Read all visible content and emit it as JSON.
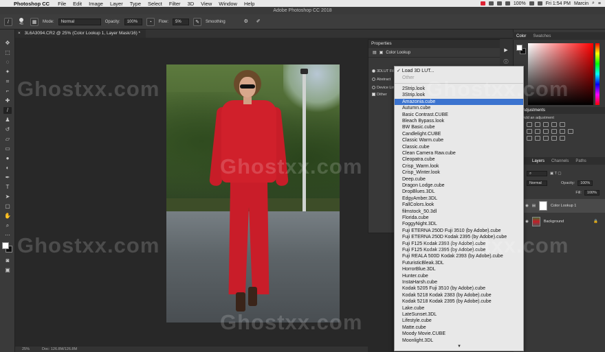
{
  "menubar": {
    "app": "Photoshop CC",
    "items": [
      "File",
      "Edit",
      "Image",
      "Layer",
      "Type",
      "Select",
      "Filter",
      "3D",
      "View",
      "Window",
      "Help"
    ],
    "battery": "100%",
    "datetime": "Fri 1:54 PM",
    "user": "Marcin"
  },
  "window_title": "Adobe Photoshop CC 2018",
  "options": {
    "brush_size": "45",
    "mode_label": "Mode:",
    "mode_value": "Normal",
    "opacity_label": "Opacity:",
    "opacity_value": "100%",
    "flow_label": "Flow:",
    "flow_value": "5%",
    "smoothing_label": "Smoothing"
  },
  "document_tab": "3L6A3094.CR2 @ 25% (Color Lookup 1, Layer Mask/16) *",
  "properties": {
    "title": "Properties",
    "subtitle": "Color Lookup",
    "opt_3dlut": "3DLUT File",
    "opt_abstract": "Abstract",
    "opt_device": "Device Link",
    "opt_dither": "Dither"
  },
  "color_panel": {
    "tab_color": "Color",
    "tab_swatches": "Swatches"
  },
  "adjustments": {
    "title": "Adjustments",
    "hint": "Add an adjustment"
  },
  "layers": {
    "tab_layers": "Layers",
    "tab_channels": "Channels",
    "tab_paths": "Paths",
    "blend": "Normal",
    "opacity_label": "Opacity:",
    "opacity_value": "100%",
    "fill_label": "Fill:",
    "fill_value": "100%",
    "items": [
      {
        "name": "Color Lookup 1"
      },
      {
        "name": "Background"
      }
    ]
  },
  "statusbar": {
    "zoom": "25%",
    "doc": "Doc: 126.8M/126.8M"
  },
  "lut_menu": {
    "load": "Load 3D LUT...",
    "other": "Other",
    "items": [
      "2Strip.look",
      "3Strip.look",
      "Amazonia.cube",
      "Autumn.cube",
      "Basic Contrast.CUBE",
      "Bleach Bypass.look",
      "BW Basic.cube",
      "Candlelight.CUBE",
      "Classic Warm.cube",
      "Classic.cube",
      "Clean Camera Raw.cube",
      "Cleopatra.cube",
      "Crisp_Warm.look",
      "Crisp_Winter.look",
      "Deep.cube",
      "Dragon Lodge.cube",
      "DropBlues.3DL",
      "EdgyAmber.3DL",
      "FallColors.look",
      "filmstock_50.3dl",
      "Florida.cube",
      "FoggyNight.3DL",
      "Fuji ETERNA 250D Fuji 3510 (by Adobe).cube",
      "Fuji ETERNA 250D Kodak 2395 (by Adobe).cube",
      "Fuji F125 Kodak 2393 (by Adobe).cube",
      "Fuji F125 Kodak 2395 (by Adobe).cube",
      "Fuji REALA 500D Kodak 2393 (by Adobe).cube",
      "FuturisticBleak.3DL",
      "HorrorBlue.3DL",
      "Hunter.cube",
      "InstaHarsh.cube",
      "Kodak 5205 Fuji 3510 (by Adobe).cube",
      "Kodak 5218 Kodak 2383 (by Adobe).cube",
      "Kodak 5218 Kodak 2395 (by Adobe).cube",
      "Lake.cube",
      "LateSunset.3DL",
      "Lifestyle.cube",
      "Matte.cube",
      "Moody Movie.CUBE",
      "Moonlight.3DL"
    ],
    "selected_index": 2
  },
  "watermark": "Ghostxx.com"
}
